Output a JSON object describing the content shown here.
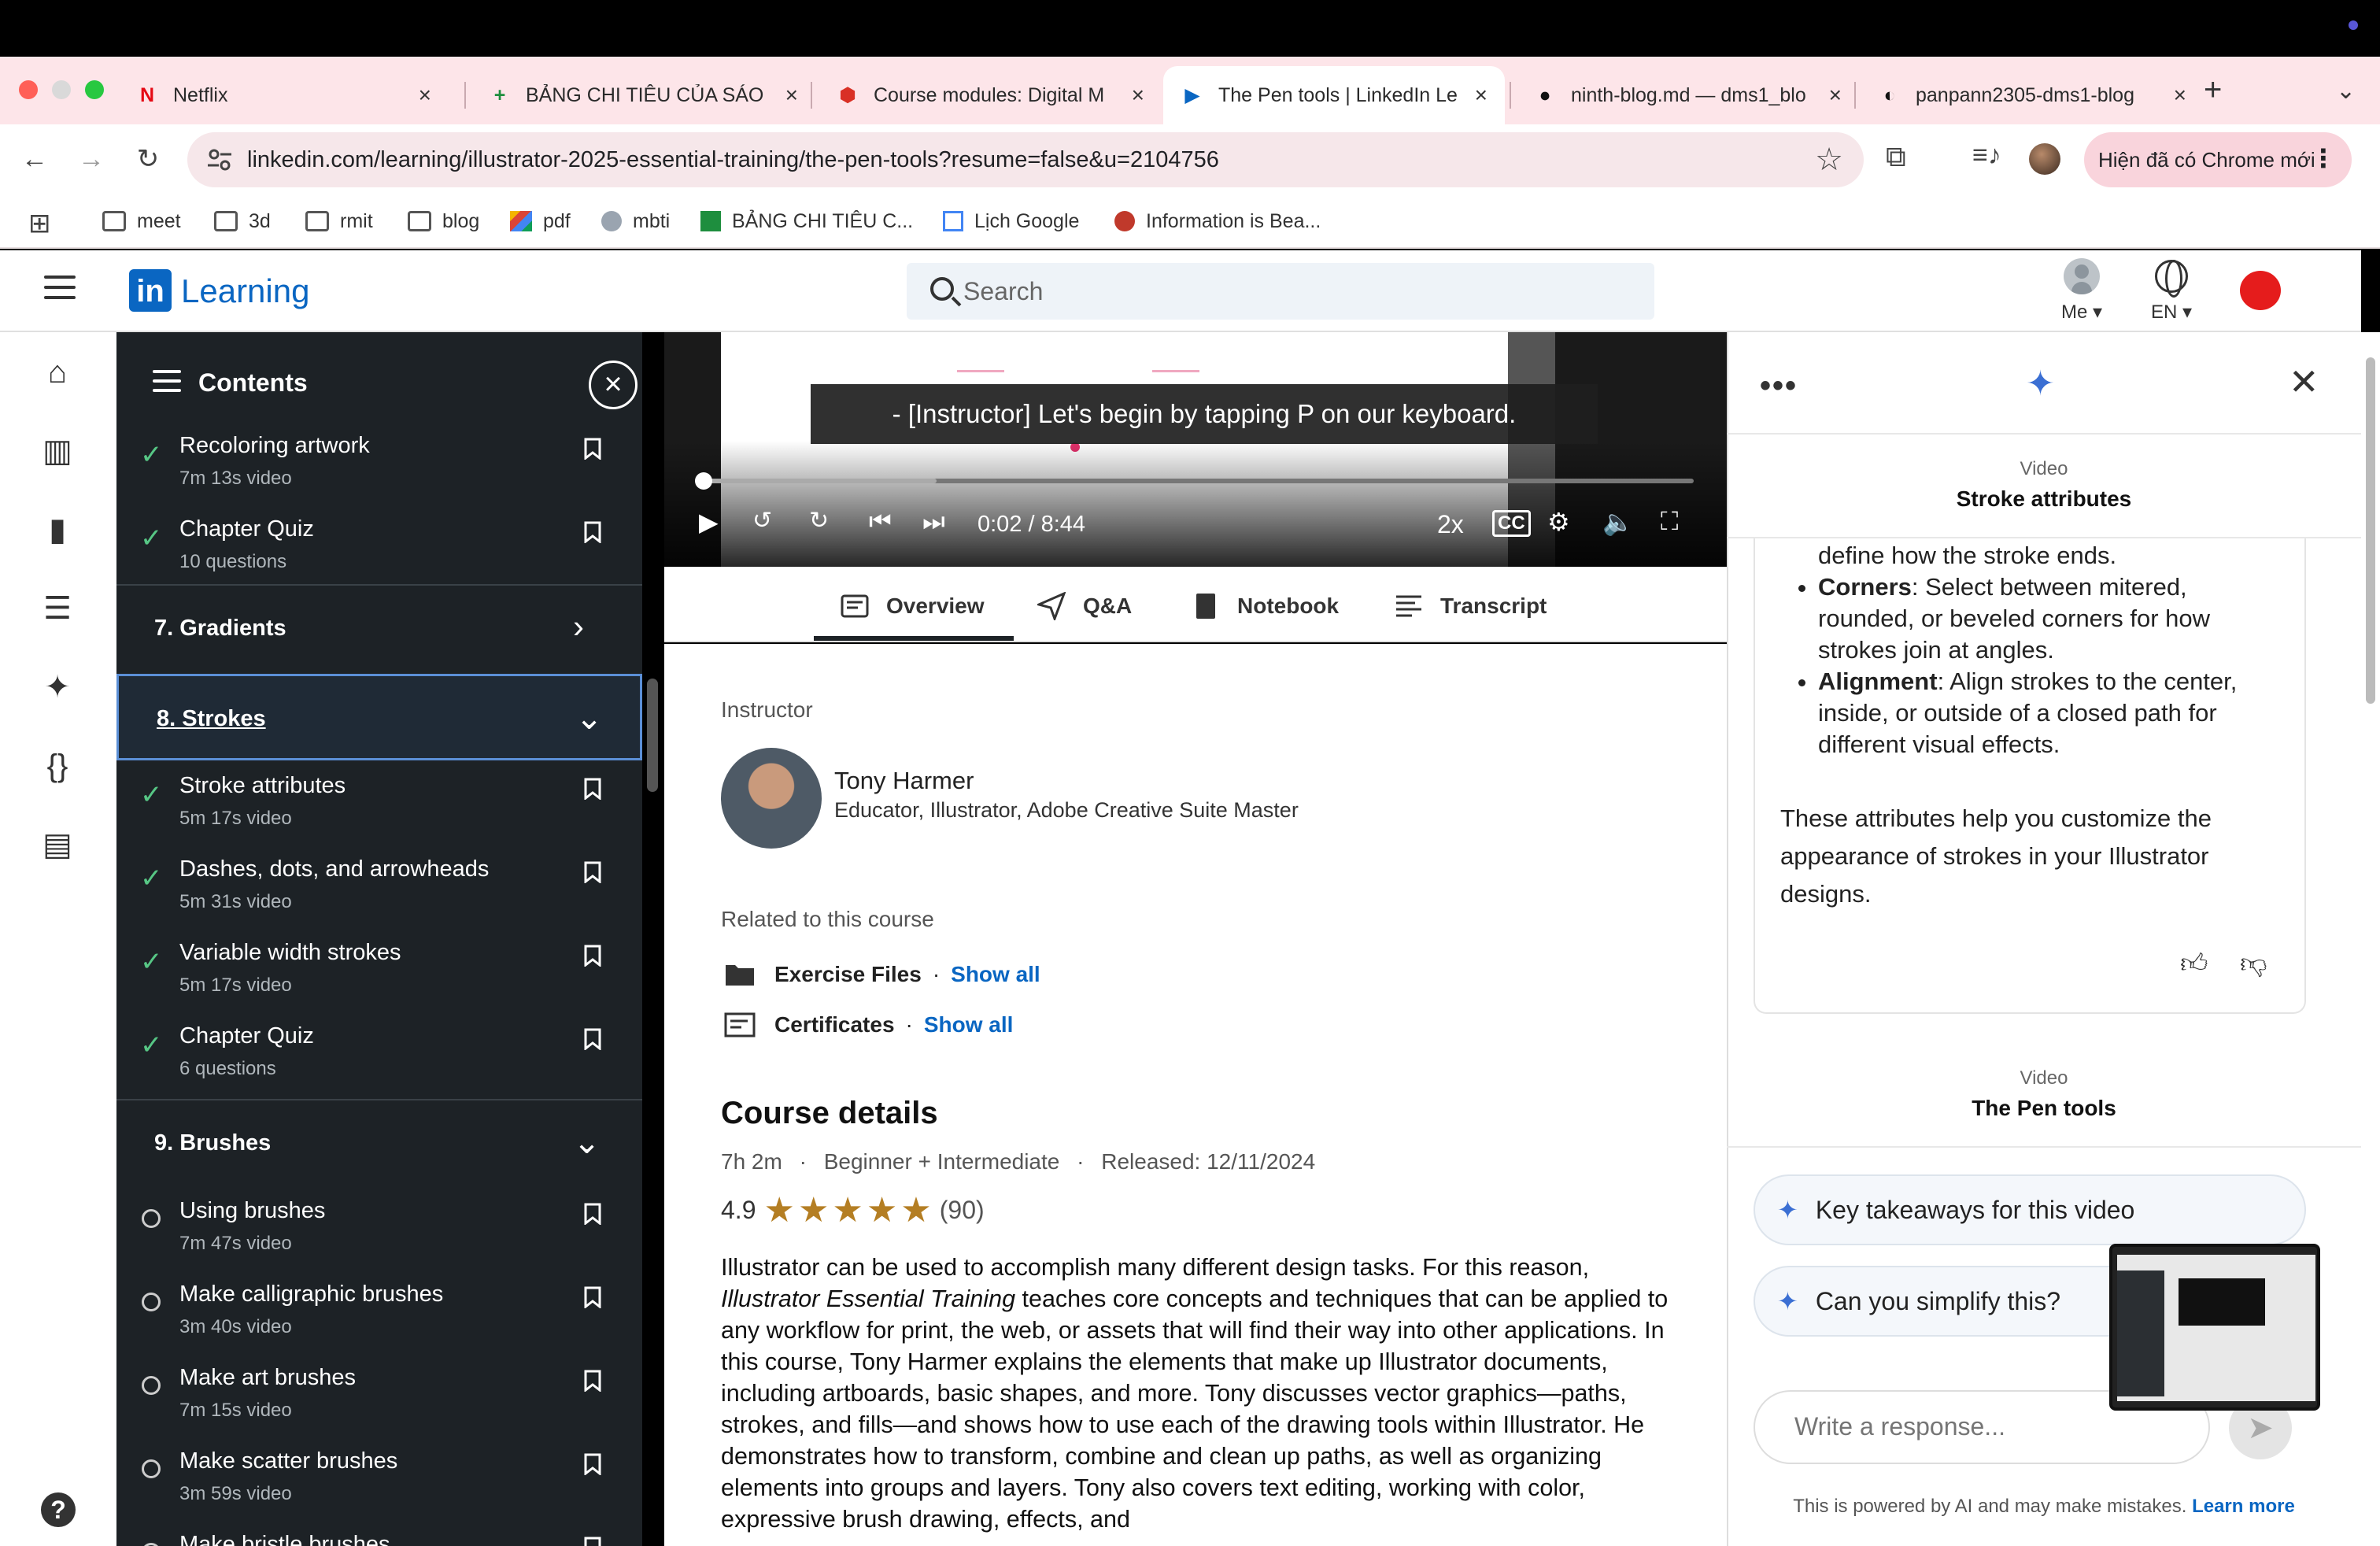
{
  "browser": {
    "tabs": [
      {
        "title": "Netflix",
        "icon": "netflix-icon",
        "fav": "N",
        "favColor": "#e50914"
      },
      {
        "title": "BẢNG CHI TIÊU CỦA SÁO",
        "icon": "sheets-icon",
        "fav": "+",
        "favColor": "#1e8e3e"
      },
      {
        "title": "Course modules: Digital M",
        "icon": "canvas-icon",
        "fav": "⬢",
        "favColor": "#d93025"
      },
      {
        "title": "The Pen tools | LinkedIn Le",
        "icon": "linkedin-learning-icon",
        "fav": "▶",
        "favColor": "#0a66c2"
      },
      {
        "title": "ninth-blog.md — dms1_blo",
        "icon": "github-icon",
        "fav": "●",
        "favColor": "#111111"
      },
      {
        "title": "panpann2305-dms1-blog",
        "icon": "vercel-icon",
        "fav": "◐",
        "favColor": "#111111"
      }
    ],
    "url": "linkedin.com/learning/illustrator-2025-essential-training/the-pen-tools?resume=false&u=2104756",
    "chrome_new_label": "Hiện đã có Chrome mới",
    "bookmarks": [
      {
        "label": "meet",
        "icon": "folder-icon"
      },
      {
        "label": "3d",
        "icon": "folder-icon"
      },
      {
        "label": "rmit",
        "icon": "folder-icon"
      },
      {
        "label": "blog",
        "icon": "folder-icon"
      },
      {
        "label": "pdf",
        "icon": "pdf-app-icon"
      },
      {
        "label": "mbti",
        "icon": "mbti-icon"
      },
      {
        "label": "BẢNG CHI TIÊU C...",
        "icon": "sheets-icon"
      },
      {
        "label": "Lịch Google",
        "icon": "calendar-icon"
      },
      {
        "label": "Information is Bea...",
        "icon": "info-beautiful-icon"
      }
    ]
  },
  "header": {
    "logo_text": "in",
    "learning_label": "Learning",
    "search_placeholder": "Search",
    "me_label": "Me",
    "lang_label": "EN"
  },
  "contents": {
    "title": "Contents",
    "items_top": [
      {
        "title": "Recoloring artwork",
        "sub": "7m 13s video",
        "done": true
      },
      {
        "title": "Chapter Quiz",
        "sub": "10 questions",
        "done": true
      }
    ],
    "section7": "7. Gradients",
    "section8": "8. Strokes",
    "items8": [
      {
        "title": "Stroke attributes",
        "sub": "5m 17s video",
        "done": true
      },
      {
        "title": "Dashes, dots, and arrowheads",
        "sub": "5m 31s video",
        "done": true
      },
      {
        "title": "Variable width strokes",
        "sub": "5m 17s video",
        "done": true
      },
      {
        "title": "Chapter Quiz",
        "sub": "6 questions",
        "done": true
      }
    ],
    "section9": "9. Brushes",
    "items9": [
      {
        "title": "Using brushes",
        "sub": "7m 47s video",
        "done": false
      },
      {
        "title": "Make calligraphic brushes",
        "sub": "3m 40s video",
        "done": false
      },
      {
        "title": "Make art brushes",
        "sub": "7m 15s video",
        "done": false
      },
      {
        "title": "Make scatter brushes",
        "sub": "3m 59s video",
        "done": false
      },
      {
        "title": "Make bristle brushes",
        "sub": "",
        "done": false
      }
    ]
  },
  "video": {
    "caption": "- [Instructor] Let's begin by tapping P on our keyboard.",
    "time": "0:02 / 8:44",
    "speed": "2x",
    "progress_fraction": 0.004
  },
  "tabs": {
    "overview": "Overview",
    "qa": "Q&A",
    "notebook": "Notebook",
    "transcript": "Transcript"
  },
  "overview": {
    "instructor_label": "Instructor",
    "instructor_name": "Tony Harmer",
    "instructor_role": "Educator, Illustrator, Adobe Creative Suite Master",
    "related_label": "Related to this course",
    "exercise_files": "Exercise Files",
    "certificates": "Certificates",
    "show_all": "Show all",
    "sep": "·",
    "course_details": "Course details",
    "duration": "7h 2m",
    "level": "Beginner + Intermediate",
    "released": "Released: 12/11/2024",
    "rating": "4.9",
    "rating_count": "(90)",
    "stars": 5,
    "description_pre": "Illustrator can be used to accomplish many different design tasks. For this reason, ",
    "description_em": "Illustrator Essential Training",
    "description_post": " teaches core concepts and techniques that can be applied to any workflow for print, the web, or assets that will find their way into other applications. In this course, Tony Harmer explains the elements that make up Illustrator documents, including artboards, basic shapes, and more. Tony discusses vector graphics—paths, strokes, and fills—and shows how to use each of the drawing tools within Illustrator. He demonstrates how to transform, combine and clean up paths, as well as organizing elements into groups and layers. Tony also covers text editing, working with color, expressive brush drawing, effects, and"
  },
  "ai": {
    "video_label": "Video",
    "video1_title": "Stroke attributes",
    "line_partial": "define how the stroke ends.",
    "bullet_corners_b": "Corners",
    "bullet_corners": ": Select between mitered, rounded, or beveled corners for how strokes join at angles.",
    "bullet_align_b": "Alignment",
    "bullet_align": ": Align strokes to the center, inside, or outside of a closed path for different visual effects.",
    "summary": "These attributes help you customize the appearance of strokes in your Illustrator designs.",
    "video2_title": "The Pen tools",
    "suggestion1": "Key takeaways for this video",
    "suggestion2": "Can you simplify this?",
    "reply_placeholder": "Write a response...",
    "footer": "This is powered by AI and may make mistakes.",
    "learn_more": "Learn more"
  }
}
